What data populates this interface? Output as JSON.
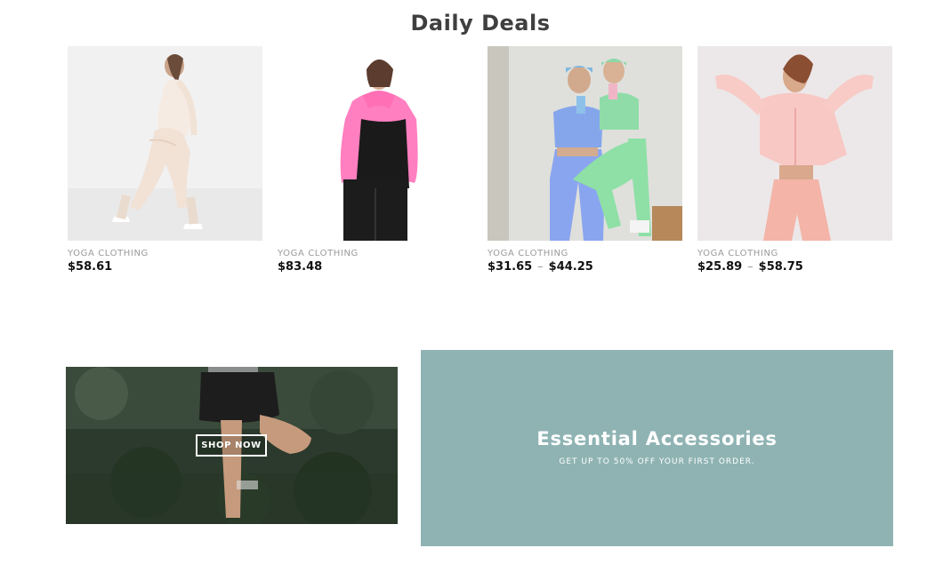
{
  "section": {
    "title": "Daily Deals"
  },
  "products": [
    {
      "category": "Yoga Clothing",
      "price": "$58.61",
      "price_high": "",
      "image_desc": "woman in white mesh yoga set"
    },
    {
      "category": "Yoga Clothing",
      "price": "$83.48",
      "price_high": "",
      "image_desc": "woman in pink and black hooded jacket"
    },
    {
      "category": "Yoga Clothing",
      "price": "$31.65",
      "price_high": "$44.25",
      "image_desc": "two women in blue and green yoga sets"
    },
    {
      "category": "Yoga Clothing",
      "price": "$25.89",
      "price_high": "$58.75",
      "image_desc": "woman in pink crop jacket and leggings"
    }
  ],
  "promo_left": {
    "button_label": "Shop Now"
  },
  "promo_right": {
    "title": "Essential Accessories",
    "subtitle": "Get up to 50% off your first order."
  },
  "colors": {
    "promo_right_bg": "#8fb3b3",
    "title": "#3f3f3f",
    "category": "#9a9a9a"
  }
}
